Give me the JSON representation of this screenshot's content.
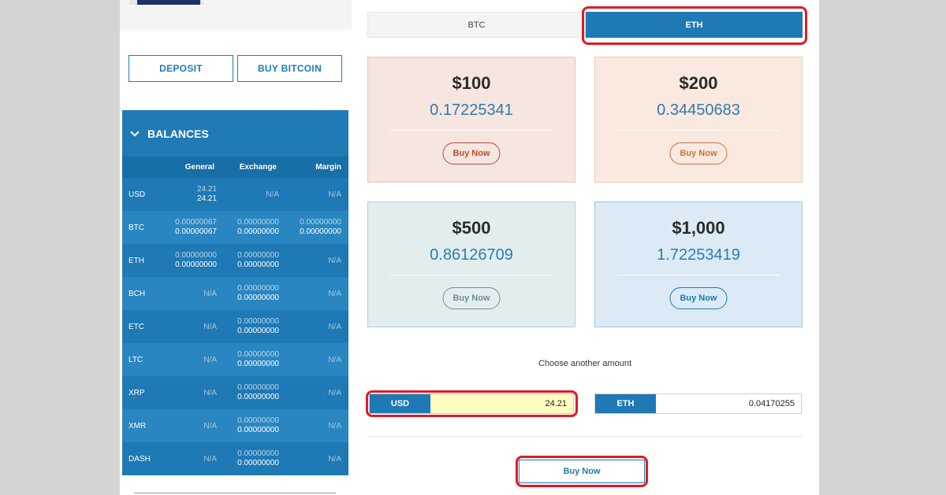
{
  "left": {
    "deposit_label": "DEPOSIT",
    "buy_bitcoin_label": "BUY BITCOIN"
  },
  "balances": {
    "title": "BALANCES",
    "columns": [
      "General",
      "Exchange",
      "Margin"
    ],
    "rows": [
      {
        "currency": "USD",
        "general": [
          "24.21",
          "24.21"
        ],
        "exchange": [
          "N/A"
        ],
        "margin": [
          "N/A"
        ]
      },
      {
        "currency": "BTC",
        "general": [
          "0.00000067",
          "0.00000067"
        ],
        "exchange": [
          "0.00000000",
          "0.00000000"
        ],
        "margin": [
          "0.00000000",
          "0.00000000"
        ]
      },
      {
        "currency": "ETH",
        "general": [
          "0.00000000",
          "0.00000000"
        ],
        "exchange": [
          "0.00000000",
          "0.00000000"
        ],
        "margin": [
          "N/A"
        ]
      },
      {
        "currency": "BCH",
        "general": [
          "N/A"
        ],
        "exchange": [
          "0.00000000",
          "0.00000000"
        ],
        "margin": [
          "N/A"
        ]
      },
      {
        "currency": "ETC",
        "general": [
          "N/A"
        ],
        "exchange": [
          "0.00000000",
          "0.00000000"
        ],
        "margin": [
          "N/A"
        ]
      },
      {
        "currency": "LTC",
        "general": [
          "N/A"
        ],
        "exchange": [
          "0.00000000",
          "0.00000000"
        ],
        "margin": [
          "N/A"
        ]
      },
      {
        "currency": "XRP",
        "general": [
          "N/A"
        ],
        "exchange": [
          "0.00000000",
          "0.00000000"
        ],
        "margin": [
          "N/A"
        ]
      },
      {
        "currency": "XMR",
        "general": [
          "N/A"
        ],
        "exchange": [
          "0.00000000",
          "0.00000000"
        ],
        "margin": [
          "N/A"
        ]
      },
      {
        "currency": "DASH",
        "general": [
          "N/A"
        ],
        "exchange": [
          "0.00000000",
          "0.00000000"
        ],
        "margin": [
          "N/A"
        ]
      }
    ]
  },
  "tabs": {
    "btc_label": "BTC",
    "eth_label": "ETH",
    "active": "ETH"
  },
  "cards": [
    {
      "price": "$100",
      "amount": "0.17225341",
      "button": "Buy Now"
    },
    {
      "price": "$200",
      "amount": "0.34450683",
      "button": "Buy Now"
    },
    {
      "price": "$500",
      "amount": "0.86126709",
      "button": "Buy Now"
    },
    {
      "price": "$1,000",
      "amount": "1.72253419",
      "button": "Buy Now"
    }
  ],
  "custom": {
    "choose_label": "Choose another amount",
    "usd_currency": "USD",
    "usd_value": "24.21",
    "eth_currency": "ETH",
    "eth_value": "0.04170255",
    "buy_label": "Buy Now"
  },
  "colors": {
    "accent": "#1e79b4",
    "highlight": "#e01b24",
    "usd_input_bg": "#fffdc0"
  }
}
